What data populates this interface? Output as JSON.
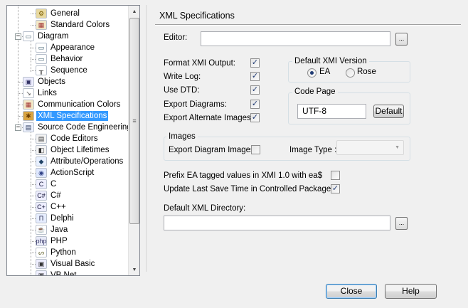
{
  "tree": {
    "items": [
      {
        "label": "General",
        "icon": "general-icon"
      },
      {
        "label": "Standard Colors",
        "icon": "palette-icon"
      },
      {
        "label": "Diagram",
        "icon": "diagram-icon"
      },
      {
        "label": "Appearance",
        "icon": "diagram-icon"
      },
      {
        "label": "Behavior",
        "icon": "diagram-icon"
      },
      {
        "label": "Sequence",
        "icon": "sequence-icon"
      },
      {
        "label": "Objects",
        "icon": "objects-icon"
      },
      {
        "label": "Links",
        "icon": "links-icon"
      },
      {
        "label": "Communication Colors",
        "icon": "palette-icon"
      },
      {
        "label": "XML Specifications",
        "icon": "xml-icon"
      },
      {
        "label": "Source Code Engineering",
        "icon": "code-icon"
      },
      {
        "label": "Code Editors",
        "icon": "editor-icon"
      },
      {
        "label": "Object Lifetimes",
        "icon": "lifetime-icon"
      },
      {
        "label": "Attribute/Operations",
        "icon": "attribute-icon"
      },
      {
        "label": "ActionScript",
        "icon": "actionscript-icon"
      },
      {
        "label": "C",
        "icon": "c-icon"
      },
      {
        "label": "C#",
        "icon": "csharp-icon"
      },
      {
        "label": "C++",
        "icon": "cpp-icon"
      },
      {
        "label": "Delphi",
        "icon": "delphi-icon"
      },
      {
        "label": "Java",
        "icon": "java-icon"
      },
      {
        "label": "PHP",
        "icon": "php-icon"
      },
      {
        "label": "Python",
        "icon": "python-icon"
      },
      {
        "label": "Visual Basic",
        "icon": "vb-icon"
      },
      {
        "label": "VB.Net",
        "icon": "vbnet-icon"
      }
    ],
    "expand_collapse": "−",
    "selected": "XML Specifications"
  },
  "panel": {
    "title": "XML Specifications",
    "editor_label": "Editor:",
    "editor_value": "",
    "browse_label": "...",
    "checkboxes": [
      {
        "label": "Format XMI Output:",
        "checked": true
      },
      {
        "label": "Write Log:",
        "checked": true
      },
      {
        "label": "Use DTD:",
        "checked": true
      },
      {
        "label": "Export Diagrams:",
        "checked": true
      },
      {
        "label": "Export Alternate Images :",
        "checked": true
      }
    ],
    "xmi_version": {
      "title": "Default XMI Version",
      "options": [
        "EA",
        "Rose"
      ],
      "selected": "EA"
    },
    "code_page": {
      "title": "Code Page",
      "value": "UTF-8",
      "default_button": "Default"
    },
    "images": {
      "title": "Images",
      "export_label": "Export Diagram Images:",
      "export_checked": false,
      "type_label": "Image Type :",
      "type_value": ""
    },
    "prefix_label": "Prefix EA tagged values in XMI 1.0 with ea$",
    "prefix_checked": false,
    "update_label": "Update Last Save Time in Controlled Packages",
    "update_checked": true,
    "dir_label": "Default XML Directory:",
    "dir_value": ""
  },
  "buttons": {
    "close": "Close",
    "help": "Help"
  },
  "colors": {
    "selection": "#3399ff",
    "check": "#1f3a73"
  }
}
